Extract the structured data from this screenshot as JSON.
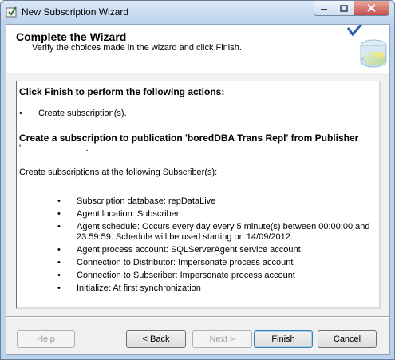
{
  "window": {
    "title": "New Subscription Wizard"
  },
  "header": {
    "title": "Complete the Wizard",
    "subtitle": "Verify the choices made in the wizard and click Finish."
  },
  "content": {
    "heading": "Click Finish to perform the following actions:",
    "actions": [
      "Create subscription(s)."
    ],
    "subscription_heading": "Create a subscription to publication 'boredDBA Trans Repl' from Publisher",
    "redacted_publisher": "'                          '.",
    "create_line": "Create subscriptions at the following Subscriber(s):",
    "details": [
      "Subscription database: repDataLive",
      "Agent location: Subscriber",
      "Agent schedule: Occurs every day every 5 minute(s) between 00:00:00 and 23:59:59. Schedule will be used starting on 14/09/2012.",
      "Agent process account: SQLServerAgent service account",
      "Connection to Distributor: Impersonate process account",
      "Connection to Subscriber: Impersonate process account",
      "Initialize: At first synchronization"
    ],
    "bullet": "•"
  },
  "buttons": {
    "help": "Help",
    "back": "< Back",
    "next": "Next >",
    "finish": "Finish",
    "cancel": "Cancel"
  }
}
